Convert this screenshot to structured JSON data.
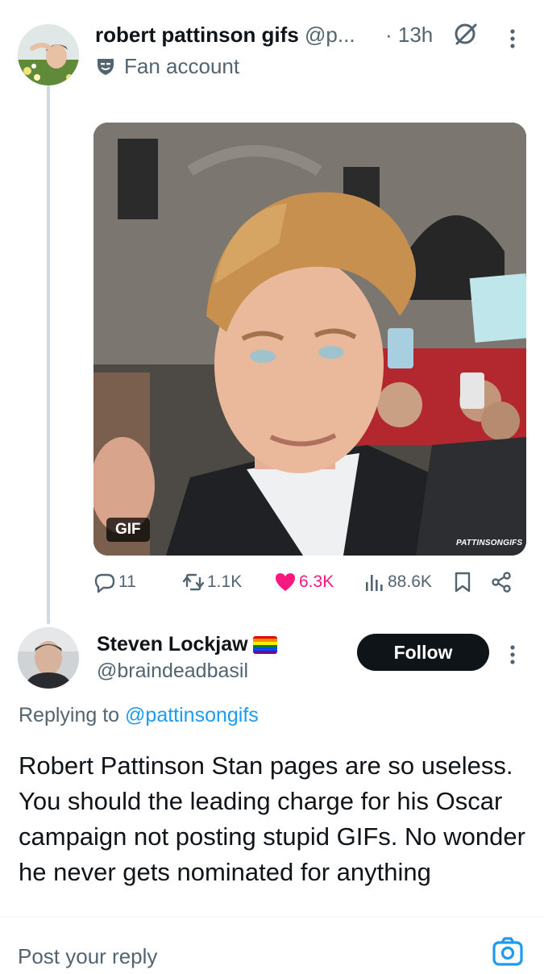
{
  "tweet": {
    "author_name": "robert pattinson gifs",
    "author_handle": "@p...",
    "time": "· 13h",
    "label_text": "Fan account",
    "media_badge": "GIF",
    "media_watermark": "PATTINSONGIFS",
    "media_description": "Close-up photo of a smiling man with tousled light hair at a red-carpet event, fans holding phones in the background",
    "stats": {
      "replies": "11",
      "reposts": "1.1K",
      "likes": "6.3K",
      "views": "88.6K"
    }
  },
  "reply": {
    "author_name": "Steven Lockjaw",
    "author_handle": "@braindeadbasil",
    "follow_label": "Follow",
    "replying_prefix": "Replying to",
    "replying_mention": "@pattinsongifs",
    "text": "Robert Pattinson Stan pages are so useless. You should the leading charge for his Oscar campaign not posting stupid GIFs. No wonder he never gets nominated for anything"
  },
  "composer": {
    "placeholder": "Post your reply"
  },
  "colors": {
    "accent": "#1d9bf0",
    "like": "#f91880",
    "text_secondary": "#536471",
    "button_dark": "#0f1419"
  },
  "icons": [
    "grok-icon",
    "more-icon",
    "fan-account-icon",
    "reply-icon",
    "repost-icon",
    "like-icon",
    "views-icon",
    "bookmark-icon",
    "share-icon",
    "pride-flag-icon",
    "camera-icon"
  ]
}
